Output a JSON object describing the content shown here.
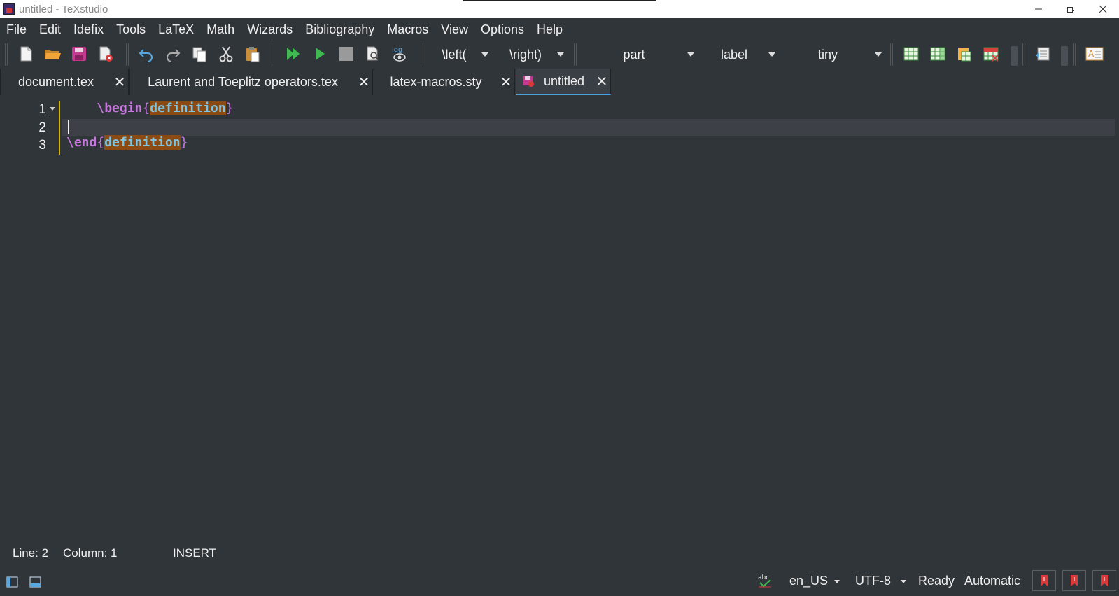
{
  "window": {
    "title": "untitled - TeXstudio",
    "controls": [
      "minimize",
      "restore",
      "close"
    ]
  },
  "menu": [
    "File",
    "Edit",
    "Idefix",
    "Tools",
    "LaTeX",
    "Math",
    "Wizards",
    "Bibliography",
    "Macros",
    "View",
    "Options",
    "Help"
  ],
  "toolbar": {
    "left_delim": "\\left(",
    "right_delim": "\\right)",
    "sectioning": "part",
    "reference": "label",
    "size": "tiny",
    "log_label": "log"
  },
  "tabs": [
    {
      "label": "document.tex",
      "active": false
    },
    {
      "label": "Laurent and Toeplitz operators.tex",
      "active": false
    },
    {
      "label": "latex-macros.sty",
      "active": false
    },
    {
      "label": "untitled",
      "active": true
    }
  ],
  "editor": {
    "line_numbers": [
      "1",
      "2",
      "3"
    ],
    "line1": {
      "indent": "    ",
      "cmd": "\\begin",
      "open": "{",
      "env": "definition",
      "close": "}"
    },
    "line3": {
      "cmd": "\\end",
      "open": "{",
      "env": "definition",
      "close": "}"
    }
  },
  "status": {
    "line": "Line: 2",
    "column": "Column: 1",
    "mode": "INSERT",
    "spell_icon_label": "abc",
    "language": "en_US",
    "encoding": "UTF-8",
    "state": "Ready",
    "compile_mode": "Automatic"
  },
  "colors": {
    "background": "#30353a",
    "keyword": "#c678dd",
    "environment_text": "#7ec3e0",
    "environment_bg": "#8a4a12",
    "fold_marker": "#d9b400",
    "active_tab_underline": "#4aa3df"
  }
}
